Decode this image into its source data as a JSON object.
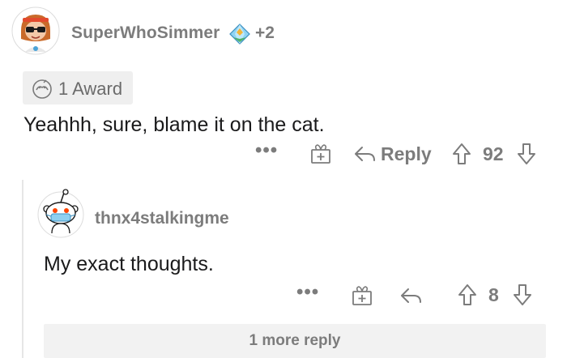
{
  "comment": {
    "author": "SuperWhoSimmer",
    "flair_extra": "+2",
    "award_label": "1 Award",
    "body": "Yeahhh, sure, blame it on the cat.",
    "actions": {
      "more": "•••",
      "reply_label": "Reply",
      "score": "92"
    }
  },
  "reply": {
    "author": "thnx4stalkingme",
    "body": "My exact thoughts.",
    "actions": {
      "more": "•••",
      "score": "8"
    }
  },
  "more_replies_label": "1 more reply",
  "icons": {
    "avatar1": "user-avatar-icon",
    "flair": "diamond-flair-icon",
    "award": "award-icon",
    "gift": "gift-icon",
    "reply": "reply-arrow-icon",
    "upvote": "upvote-arrow-icon",
    "downvote": "downvote-arrow-icon",
    "avatar2": "snoo-avatar-icon"
  },
  "colors": {
    "meta_text": "#7c7c7c",
    "body_text": "#1a1a1b",
    "pill_bg": "#efefef"
  }
}
